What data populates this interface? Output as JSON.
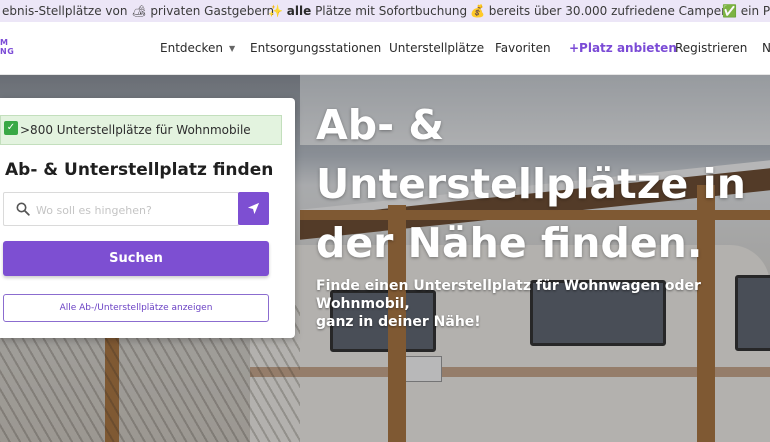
{
  "topbar": {
    "item1": "ebnis-Stellplätze von 🏕 privaten Gastgebern",
    "item2_icon": "✨",
    "item2_bold": "alle",
    "item2_rest": " Plätze mit Sofortbuchung",
    "item3_icon": "💰",
    "item3": "bereits über 30.000 zufriedene Camper",
    "item4_icon": "✅",
    "item4": "ein Pre"
  },
  "logo": {
    "line1": "M",
    "line2": "NG"
  },
  "nav": {
    "entdecken": "Entdecken",
    "entsorgung": "Entsorgungsstationen",
    "unterstell": "Unterstellplätze",
    "favoriten": "Favoriten",
    "platz_anbieten": "+Platz anbieten",
    "registrieren": "Registrieren",
    "more": "N"
  },
  "search_card": {
    "badge": ">800 Unterstellplätze für Wohnmobile",
    "title": "Ab- & Unterstellplatz finden",
    "placeholder": "Wo soll es hingehen?",
    "search_button": "Suchen",
    "all_button": "Alle Ab-/Unterstellplätze anzeigen"
  },
  "hero": {
    "title_line1": "Ab- &",
    "title_line2": "Unterstellplätze in",
    "title_line3": "der Nähe finden.",
    "subtitle_line1": "Finde einen Unterstellplatz für Wohnwagen oder Wohnmobil,",
    "subtitle_line2": "ganz in deiner Nähe!"
  },
  "colors": {
    "brand": "#7d4fd2",
    "topbar_bg": "#ece6f7",
    "badge_bg": "#e3f3df"
  }
}
